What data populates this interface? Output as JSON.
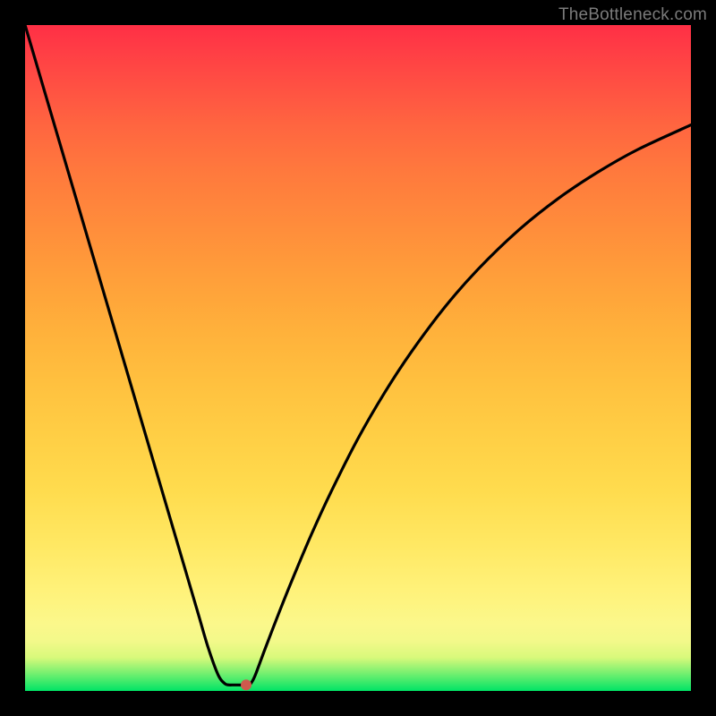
{
  "watermark": "TheBottleneck.com",
  "chart_data": {
    "type": "line",
    "title": "",
    "xlabel": "",
    "ylabel": "",
    "xlim": [
      0,
      100
    ],
    "ylim": [
      0,
      100
    ],
    "series": [
      {
        "name": "curve",
        "x": [
          0,
          3,
          6,
          9,
          12,
          15,
          18,
          21,
          24,
          26,
          27.5,
          29,
          30,
          30.7,
          31,
          31.3,
          33.5,
          33.8,
          34.5,
          36,
          38,
          40,
          43,
          46,
          50,
          54,
          58,
          63,
          68,
          74,
          80,
          86,
          92,
          100
        ],
        "y": [
          100,
          89.8,
          79.6,
          69.4,
          59.2,
          49,
          38.8,
          28.6,
          18.4,
          11.6,
          6.5,
          2.4,
          1.1,
          0.9,
          0.9,
          0.9,
          0.9,
          1.0,
          2.2,
          6.2,
          11.4,
          16.4,
          23.5,
          30,
          37.9,
          44.8,
          50.9,
          57.6,
          63.3,
          69.1,
          73.9,
          77.9,
          81.3,
          85
        ]
      }
    ],
    "marker": {
      "x": 33.2,
      "y": 0.9,
      "color": "#cf5a4d",
      "radius_px": 6
    },
    "background_gradient": {
      "stops": [
        {
          "pos": 0.0,
          "color": "#00e466"
        },
        {
          "pos": 0.025,
          "color": "#6fef6f"
        },
        {
          "pos": 0.05,
          "color": "#d8f97b"
        },
        {
          "pos": 0.075,
          "color": "#f3f98a"
        },
        {
          "pos": 0.1,
          "color": "#fbf88b"
        },
        {
          "pos": 0.15,
          "color": "#fff27a"
        },
        {
          "pos": 0.22,
          "color": "#ffe863"
        },
        {
          "pos": 0.3,
          "color": "#ffdc4e"
        },
        {
          "pos": 0.38,
          "color": "#ffcf45"
        },
        {
          "pos": 0.46,
          "color": "#ffc13f"
        },
        {
          "pos": 0.54,
          "color": "#ffb13b"
        },
        {
          "pos": 0.62,
          "color": "#ff9f3a"
        },
        {
          "pos": 0.7,
          "color": "#ff8c3b"
        },
        {
          "pos": 0.78,
          "color": "#ff793d"
        },
        {
          "pos": 0.85,
          "color": "#ff6540"
        },
        {
          "pos": 0.91,
          "color": "#ff5043"
        },
        {
          "pos": 0.96,
          "color": "#ff3e45"
        },
        {
          "pos": 1.0,
          "color": "#ff2f45"
        }
      ]
    }
  }
}
